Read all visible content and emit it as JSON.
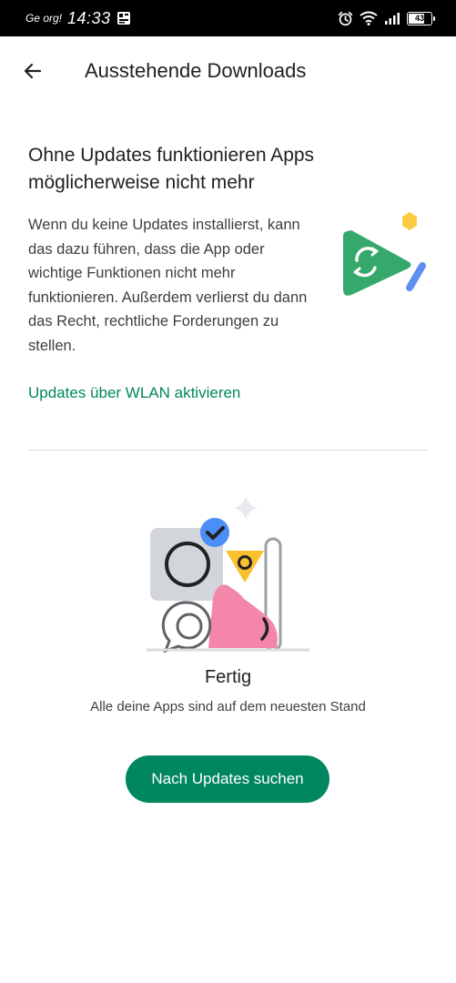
{
  "status_bar": {
    "carrier": "Ge org!",
    "time": "14:33",
    "battery": "43",
    "icons": [
      "notification-icon",
      "alarm-icon",
      "wifi-icon",
      "signal-icon",
      "battery-icon"
    ]
  },
  "app_bar": {
    "back_icon": "arrow-back-icon",
    "title": "Ausstehende Downloads"
  },
  "warning": {
    "heading": "Ohne Updates funktionieren Apps möglicherweise nicht mehr",
    "body": "Wenn du keine Updates installierst, kann das dazu führen, dass die App oder wichtige Funktionen nicht mehr funktionieren. Außerdem verlierst du dann das Recht, rechtliche Forderungen zu stellen.",
    "link": "Updates über WLAN aktivieren"
  },
  "done": {
    "title": "Fertig",
    "subtitle": "Alle deine Apps sind auf dem neuesten Stand",
    "button": "Nach Updates suchen"
  },
  "colors": {
    "accent": "#01875f",
    "status_bar": "#000000",
    "background": "#ffffff"
  }
}
